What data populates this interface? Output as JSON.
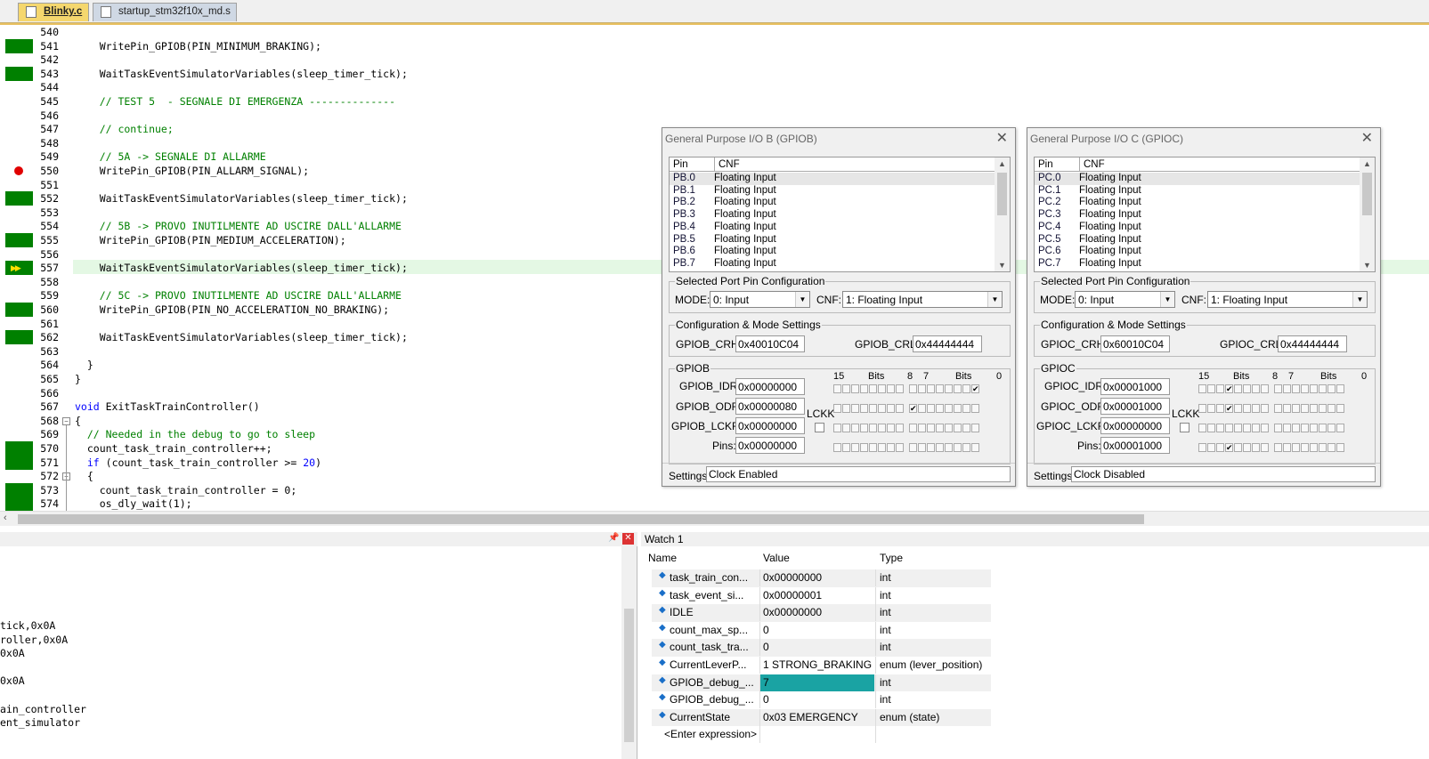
{
  "tabs": [
    {
      "label": "Blinky.c"
    },
    {
      "label": "startup_stm32f10x_md.s"
    }
  ],
  "editor": {
    "lines": [
      {
        "n": "540",
        "code": "",
        "cov": false
      },
      {
        "n": "541",
        "code": "    WritePin_GPIOB(PIN_MINIMUM_BRAKING);",
        "cov": true
      },
      {
        "n": "542",
        "code": "",
        "cov": false
      },
      {
        "n": "543",
        "code": "    WaitTaskEventSimulatorVariables(sleep_timer_tick);",
        "cov": true
      },
      {
        "n": "544",
        "code": "",
        "cov": false
      },
      {
        "n": "545",
        "code": "    // TEST 5  - SEGNALE DI EMERGENZA --------------",
        "cov": false,
        "cmt": true
      },
      {
        "n": "546",
        "code": "",
        "cov": false
      },
      {
        "n": "547",
        "code": "    // continue;",
        "cov": false,
        "cmt": true
      },
      {
        "n": "548",
        "code": "",
        "cov": false
      },
      {
        "n": "549",
        "code": "    // 5A -> SEGNALE DI ALLARME",
        "cov": false,
        "cmt": true
      },
      {
        "n": "550",
        "code": "    WritePin_GPIOB(PIN_ALLARM_SIGNAL);",
        "cov": false,
        "bp": true
      },
      {
        "n": "551",
        "code": "",
        "cov": false
      },
      {
        "n": "552",
        "code": "    WaitTaskEventSimulatorVariables(sleep_timer_tick);",
        "cov": true
      },
      {
        "n": "553",
        "code": "",
        "cov": false
      },
      {
        "n": "554",
        "code": "    // 5B -> PROVO INUTILMENTE AD USCIRE DALL'ALLARME",
        "cov": false,
        "cmt": true
      },
      {
        "n": "555",
        "code": "    WritePin_GPIOB(PIN_MEDIUM_ACCELERATION);",
        "cov": true
      },
      {
        "n": "556",
        "code": "",
        "cov": false
      },
      {
        "n": "557",
        "code": "    WaitTaskEventSimulatorVariables(sleep_timer_tick);",
        "cov": true,
        "arrow": true
      },
      {
        "n": "558",
        "code": "",
        "cov": false
      },
      {
        "n": "559",
        "code": "    // 5C -> PROVO INUTILMENTE AD USCIRE DALL'ALLARME",
        "cov": false,
        "cmt": true
      },
      {
        "n": "560",
        "code": "    WritePin_GPIOB(PIN_NO_ACCELERATION_NO_BRAKING);",
        "cov": true
      },
      {
        "n": "561",
        "code": "",
        "cov": false
      },
      {
        "n": "562",
        "code": "    WaitTaskEventSimulatorVariables(sleep_timer_tick);",
        "cov": true
      },
      {
        "n": "563",
        "code": "",
        "cov": false
      },
      {
        "n": "564",
        "code": "  }",
        "cov": false
      },
      {
        "n": "565",
        "code": "}",
        "cov": false
      },
      {
        "n": "566",
        "code": "",
        "cov": false
      },
      {
        "n": "567",
        "code": "void ExitTaskTrainController()",
        "cov": false,
        "kwv": true
      },
      {
        "n": "568",
        "code": "{",
        "cov": false,
        "fold": true
      },
      {
        "n": "569",
        "code": "  // Needed in the debug to go to sleep",
        "cov": false,
        "cmt": true
      },
      {
        "n": "570",
        "code": "  count_task_train_controller++;",
        "cov": true
      },
      {
        "n": "571",
        "code": "  if (count_task_train_controller >= 20)",
        "cov": true,
        "kwif": true
      },
      {
        "n": "572",
        "code": "  {",
        "cov": false,
        "fold": true
      },
      {
        "n": "573",
        "code": "    count_task_train_controller = 0;",
        "cov": true
      },
      {
        "n": "574",
        "code": "    os_dly_wait(1);",
        "cov": true
      }
    ]
  },
  "gpiob": {
    "title": "General Purpose I/O B (GPIOB)",
    "col_pin": "Pin",
    "col_cnf": "CNF",
    "pins": [
      {
        "p": "PB.0",
        "c": "Floating Input"
      },
      {
        "p": "PB.1",
        "c": "Floating Input"
      },
      {
        "p": "PB.2",
        "c": "Floating Input"
      },
      {
        "p": "PB.3",
        "c": "Floating Input"
      },
      {
        "p": "PB.4",
        "c": "Floating Input"
      },
      {
        "p": "PB.5",
        "c": "Floating Input"
      },
      {
        "p": "PB.6",
        "c": "Floating Input"
      },
      {
        "p": "PB.7",
        "c": "Floating Input"
      }
    ],
    "sel_group": "Selected Port Pin Configuration",
    "mode_label": "MODE:",
    "mode_value": "0: Input",
    "cnf_label": "CNF:",
    "cnf_value": "1: Floating Input",
    "cfg_group": "Configuration & Mode Settings",
    "crh_label": "GPIOB_CRH:",
    "crh_value": "0x40010C04",
    "crl_label": "GPIOB_CRL:",
    "crl_value": "0x44444444",
    "port_group": "GPIOB",
    "bits_hi": "15",
    "bits_label": "Bits",
    "bits_8": "8",
    "bits_7": "7",
    "bits_0": "0",
    "idr_label": "GPIOB_IDR:",
    "idr_value": "0x00000000",
    "odr_label": "GPIOB_ODR:",
    "odr_value": "0x00000080",
    "lckr_label": "GPIOB_LCKR:",
    "lckr_value": "0x00000000",
    "pins_label": "Pins:",
    "pins_value": "0x00000000",
    "lckk_label": "LCKK",
    "settings_label": "Settings:",
    "settings_value": "Clock Enabled"
  },
  "gpioc": {
    "title": "General Purpose I/O C (GPIOC)",
    "col_pin": "Pin",
    "col_cnf": "CNF",
    "pins": [
      {
        "p": "PC.0",
        "c": "Floating Input"
      },
      {
        "p": "PC.1",
        "c": "Floating Input"
      },
      {
        "p": "PC.2",
        "c": "Floating Input"
      },
      {
        "p": "PC.3",
        "c": "Floating Input"
      },
      {
        "p": "PC.4",
        "c": "Floating Input"
      },
      {
        "p": "PC.5",
        "c": "Floating Input"
      },
      {
        "p": "PC.6",
        "c": "Floating Input"
      },
      {
        "p": "PC.7",
        "c": "Floating Input"
      }
    ],
    "sel_group": "Selected Port Pin Configuration",
    "mode_label": "MODE:",
    "mode_value": "0: Input",
    "cnf_label": "CNF:",
    "cnf_value": "1: Floating Input",
    "cfg_group": "Configuration & Mode Settings",
    "crh_label": "GPIOC_CRH:",
    "crh_value": "0x60010C04",
    "crl_label": "GPIOC_CRL:",
    "crl_value": "0x44444444",
    "port_group": "GPIOC",
    "bits_hi": "15",
    "bits_label": "Bits",
    "bits_8": "8",
    "bits_7": "7",
    "bits_0": "0",
    "idr_label": "GPIOC_IDR:",
    "idr_value": "0x00001000",
    "odr_label": "GPIOC_ODR:",
    "odr_value": "0x00001000",
    "lckr_label": "GPIOC_LCKR:",
    "lckr_value": "0x00000000",
    "pins_label": "Pins:",
    "pins_value": "0x00001000",
    "lckk_label": "LCKK",
    "settings_label": "Settings:",
    "settings_value": "Clock Disabled"
  },
  "left_panel": {
    "lines": [
      "tick,0x0A",
      "roller,0x0A",
      "0x0A",
      "",
      "0x0A",
      "",
      "ain_controller",
      "ent_simulator"
    ]
  },
  "watch": {
    "title": "Watch 1",
    "col_name": "Name",
    "col_value": "Value",
    "col_type": "Type",
    "rows": [
      {
        "name": "task_train_con...",
        "value": "0x00000000",
        "type": "int"
      },
      {
        "name": "task_event_si...",
        "value": "0x00000001",
        "type": "int"
      },
      {
        "name": "IDLE",
        "value": "0x00000000",
        "type": "int"
      },
      {
        "name": "count_max_sp...",
        "value": "0",
        "type": "int"
      },
      {
        "name": "count_task_tra...",
        "value": "0",
        "type": "int"
      },
      {
        "name": "CurrentLeverP...",
        "value": "1 STRONG_BRAKING",
        "type": "enum (lever_position)"
      },
      {
        "name": "GPIOB_debug_...",
        "value": "7",
        "type": "int",
        "hl": true
      },
      {
        "name": "GPIOB_debug_...",
        "value": "0",
        "type": "int"
      },
      {
        "name": "CurrentState",
        "value": "0x03 EMERGENCY",
        "type": "enum (state)"
      }
    ],
    "enter_expr": "<Enter expression>"
  }
}
